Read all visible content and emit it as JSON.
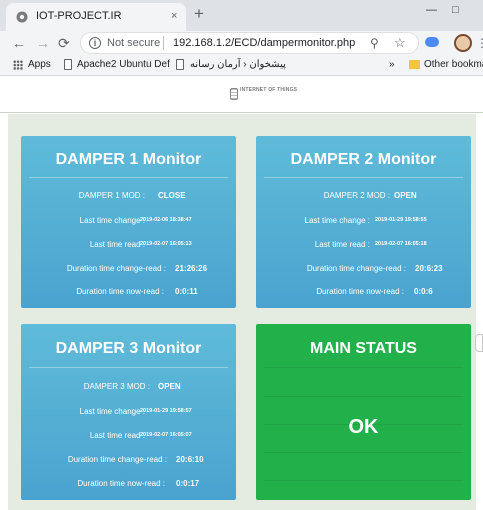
{
  "browser": {
    "tab_title": "IOT-PROJECT.IR",
    "tab_close": "×",
    "new_tab": "+",
    "back": "←",
    "forward": "→",
    "reload": "⟳",
    "security_label": "Not secure",
    "url": "192.168.1.2/ECD/dampermonitor.php",
    "bookmarks": {
      "apps": "Apps",
      "item1": "Apache2 Ubuntu Def",
      "item2": "پیشخوان ‹ آرمان رسانه",
      "overflow": "»",
      "other": "Other bookmarks"
    },
    "icons": [
      "favicon-icon",
      "back-icon",
      "forward-icon",
      "reload-icon",
      "info-icon",
      "zoom-icon",
      "star-icon",
      "cloud-extension-icon",
      "profile-avatar",
      "menu-icon",
      "apps-icon",
      "page-icon",
      "folder-icon"
    ]
  },
  "page": {
    "logo_text": "INTERNET OF THINGS",
    "dampers": [
      {
        "title": "DAMPER 1 Monitor",
        "mod_label": "DAMPER 1 MOD :",
        "mod_value": "CLOSE",
        "last_change_label": "Last time change :",
        "last_change_value": "2019-02-06 18:38:47",
        "last_read_label": "Last time read :",
        "last_read_value": "2019-02-07 16:05:13",
        "change_read_label": "Duration time change-read :",
        "change_read_value": "21:26:26",
        "now_read_label": "Duration time now-read :",
        "now_read_value": "0:0:11"
      },
      {
        "title": "DAMPER 2 Monitor",
        "mod_label": "DAMPER 2 MOD :",
        "mod_value": "OPEN",
        "last_change_label": "Last time change :",
        "last_change_value": "2019-01-29 19:58:55",
        "last_read_label": "Last time read :",
        "last_read_value": "2019-02-07 16:05:18",
        "change_read_label": "Duration time change-read :",
        "change_read_value": "20:6:23",
        "now_read_label": "Duration time now-read :",
        "now_read_value": "0:0:6"
      },
      {
        "title": "DAMPER 3 Monitor",
        "mod_label": "DAMPER 3 MOD :",
        "mod_value": "OPEN",
        "last_change_label": "Last time change :",
        "last_change_value": "2019-01-29 19:58:57",
        "last_read_label": "Last time read :",
        "last_read_value": "2019-02-07 16:05:07",
        "change_read_label": "Duration time change-read :",
        "change_read_value": "20:6:10",
        "now_read_label": "Duration time now-read :",
        "now_read_value": "0:0:17"
      }
    ],
    "main_status": {
      "title": "MAIN STATUS",
      "value": "OK"
    }
  },
  "colors": {
    "damper_card": "#4fabd3",
    "status_card": "#21b04a",
    "page_background": "#e4ebe0"
  }
}
